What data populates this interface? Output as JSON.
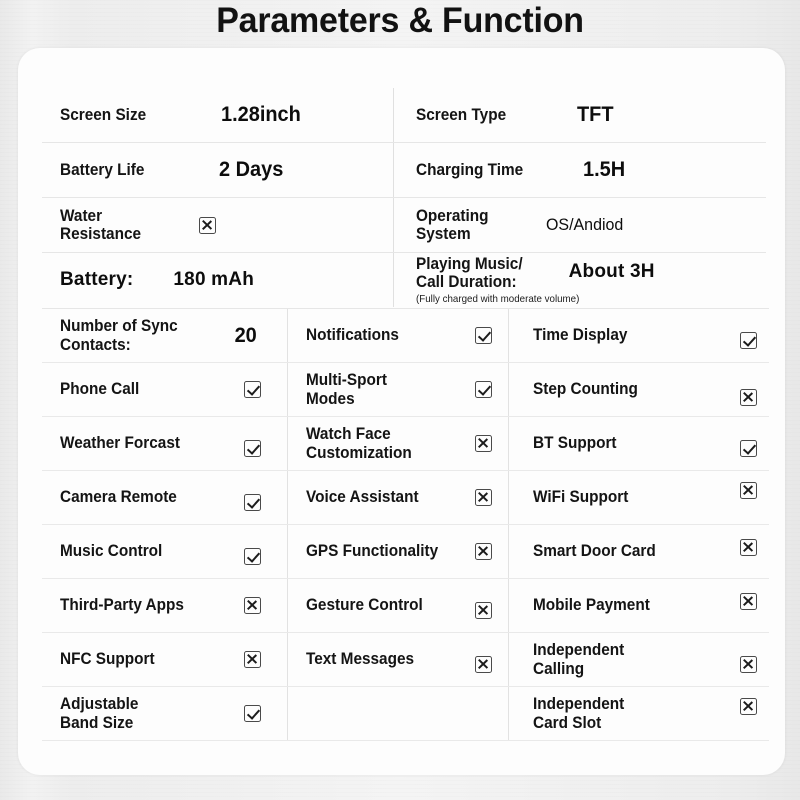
{
  "page": {
    "title": "Parameters & Function",
    "background_color": "#eeeeee",
    "card_color": "#fdfdfd",
    "text_color": "#141414"
  },
  "specs": [
    {
      "left": {
        "label": "Screen Size",
        "value": "1.28inch",
        "type": "text"
      },
      "right": {
        "label": "Screen Type",
        "value": "TFT",
        "type": "text"
      }
    },
    {
      "left": {
        "label": "Battery Life",
        "value": "2 Days",
        "type": "text"
      },
      "right": {
        "label": "Charging Time",
        "value": "1.5H",
        "type": "text"
      }
    },
    {
      "left": {
        "label": "Water\nResistance",
        "value": "",
        "type": "checkbox",
        "state": "cross"
      },
      "right": {
        "label": "Operating\nSystem",
        "value": "OS/Andiod",
        "type": "text"
      }
    },
    {
      "left": {
        "label": "Battery:",
        "value": "180 mAh",
        "type": "text"
      },
      "right": {
        "label": "Playing Music/\nCall Duration:",
        "value": "About 3H",
        "type": "text",
        "note": "(Fully charged with moderate volume)"
      }
    }
  ],
  "features": [
    [
      {
        "label": "Number of Sync\nContacts:",
        "type": "number",
        "value": "20"
      },
      {
        "label": "Notifications",
        "type": "checkbox",
        "state": "check"
      },
      {
        "label": "Time Display",
        "type": "checkbox",
        "state": "check"
      }
    ],
    [
      {
        "label": "Phone Call",
        "type": "checkbox",
        "state": "check"
      },
      {
        "label": "Multi-Sport\nModes",
        "type": "checkbox",
        "state": "check"
      },
      {
        "label": "Step Counting",
        "type": "checkbox",
        "state": "cross"
      }
    ],
    [
      {
        "label": "Weather Forcast",
        "type": "checkbox",
        "state": "check"
      },
      {
        "label": "Watch Face\nCustomization",
        "type": "checkbox",
        "state": "cross"
      },
      {
        "label": "BT Support",
        "type": "checkbox",
        "state": "check"
      }
    ],
    [
      {
        "label": "Camera Remote",
        "type": "checkbox",
        "state": "check"
      },
      {
        "label": "Voice Assistant",
        "type": "checkbox",
        "state": "cross"
      },
      {
        "label": "WiFi Support",
        "type": "checkbox",
        "state": "cross"
      }
    ],
    [
      {
        "label": "Music Control",
        "type": "checkbox",
        "state": "check"
      },
      {
        "label": "GPS Functionality",
        "type": "checkbox",
        "state": "cross"
      },
      {
        "label": "Smart Door Card",
        "type": "checkbox",
        "state": "cross"
      }
    ],
    [
      {
        "label": "Third-Party Apps",
        "type": "checkbox",
        "state": "cross"
      },
      {
        "label": "Gesture Control",
        "type": "checkbox",
        "state": "cross"
      },
      {
        "label": "Mobile Payment",
        "type": "checkbox",
        "state": "cross"
      }
    ],
    [
      {
        "label": "NFC Support",
        "type": "checkbox",
        "state": "cross"
      },
      {
        "label": "Text Messages",
        "type": "checkbox",
        "state": "cross"
      },
      {
        "label": "Independent\nCalling",
        "type": "checkbox",
        "state": "cross"
      }
    ],
    [
      {
        "label": "Adjustable\nBand Size",
        "type": "checkbox",
        "state": "check"
      },
      {
        "label": "",
        "type": "empty"
      },
      {
        "label": "Independent\nCard Slot",
        "type": "checkbox",
        "state": "cross"
      }
    ]
  ]
}
